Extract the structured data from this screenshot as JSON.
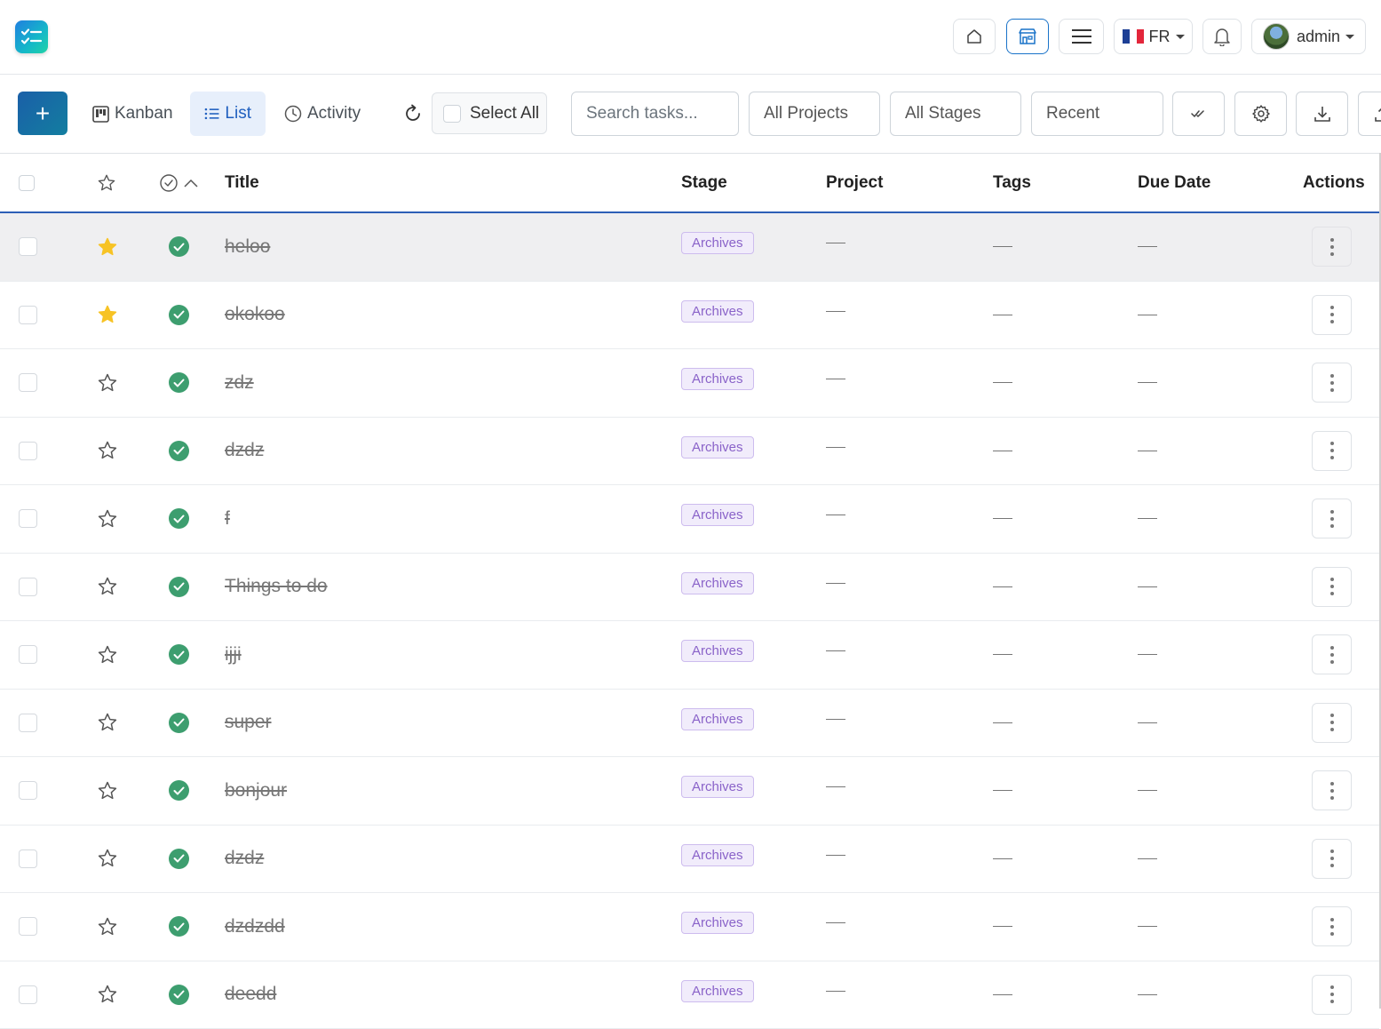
{
  "header": {
    "logo_icon": "task-checklist-icon",
    "language": "FR",
    "user": "admin",
    "buttons": [
      "home-icon",
      "store-icon",
      "menu-icon",
      "bell-icon"
    ]
  },
  "toolbar": {
    "add_label": "+",
    "views": [
      {
        "label": "Kanban",
        "icon": "kanban-icon",
        "active": false
      },
      {
        "label": "List",
        "icon": "list-icon",
        "active": true
      },
      {
        "label": "Activity",
        "icon": "clock-icon",
        "active": false
      }
    ],
    "select_all": "Select All",
    "search_placeholder": "Search tasks...",
    "projects_filter": "All Projects",
    "stages_filter": "All Stages",
    "sort": "Recent"
  },
  "table": {
    "columns": {
      "title": "Title",
      "stage": "Stage",
      "project": "Project",
      "tags": "Tags",
      "due_date": "Due Date",
      "actions": "Actions"
    },
    "rows": [
      {
        "title": "heloo",
        "starred": true,
        "stage": "Archives",
        "highlight": true
      },
      {
        "title": "okokoo",
        "starred": true,
        "stage": "Archives"
      },
      {
        "title": "zdz",
        "starred": false,
        "stage": "Archives"
      },
      {
        "title": "dzdz",
        "starred": false,
        "stage": "Archives"
      },
      {
        "title": "f",
        "starred": false,
        "stage": "Archives"
      },
      {
        "title": "Things to do",
        "starred": false,
        "stage": "Archives"
      },
      {
        "title": "ijji",
        "starred": false,
        "stage": "Archives"
      },
      {
        "title": "super",
        "starred": false,
        "stage": "Archives"
      },
      {
        "title": "bonjour",
        "starred": false,
        "stage": "Archives"
      },
      {
        "title": "dzdz",
        "starred": false,
        "stage": "Archives"
      },
      {
        "title": "dzdzdd",
        "starred": false,
        "stage": "Archives"
      },
      {
        "title": "deedd",
        "starred": false,
        "stage": "Archives"
      }
    ]
  },
  "colors": {
    "accent": "#1a73c9",
    "done_green": "#3d9e6f",
    "star_gold": "#f7c325",
    "badge_purple": "#8a63c9"
  }
}
